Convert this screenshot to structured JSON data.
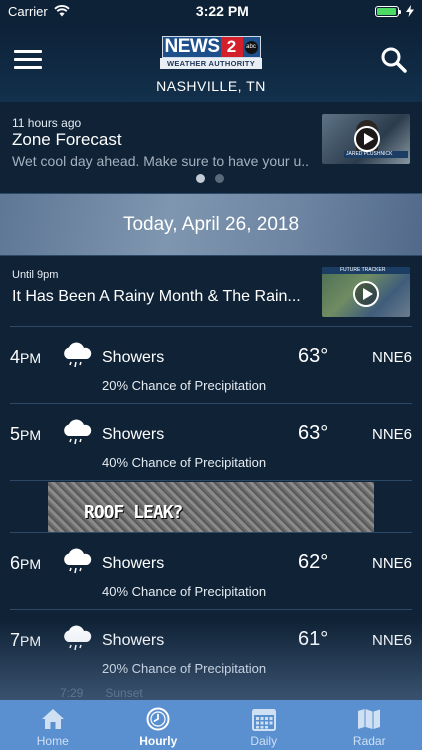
{
  "status_bar": {
    "carrier": "Carrier",
    "time": "3:22 PM",
    "battery_level": 0.95
  },
  "header": {
    "logo_text": "NEWS",
    "logo_number": "2",
    "logo_abc": "abc",
    "logo_subtitle": "WEATHER AUTHORITY",
    "location": "NASHVILLE, TN"
  },
  "forecast_card": {
    "time_ago": "11 hours ago",
    "title": "Zone Forecast",
    "description": "Wet cool day ahead. Make sure to have your u...",
    "thumbnail_caption": "JARED PLUSHNICK",
    "dots_active_index": 0
  },
  "date_banner": {
    "text": "Today, April 26, 2018"
  },
  "story": {
    "until": "Until 9pm",
    "title": "It Has Been A Rainy Month & The Rain...",
    "thumbnail_caption": "FUTURE TRACKER"
  },
  "hourly": [
    {
      "hour": "4",
      "ampm": "PM",
      "condition": "Showers",
      "temp": "63°",
      "wind": "NNE6",
      "precip": "20% Chance of Precipitation"
    },
    {
      "hour": "5",
      "ampm": "PM",
      "condition": "Showers",
      "temp": "63°",
      "wind": "NNE6",
      "precip": "40% Chance of Precipitation"
    },
    {
      "hour": "6",
      "ampm": "PM",
      "condition": "Showers",
      "temp": "62°",
      "wind": "NNE6",
      "precip": "40% Chance of Precipitation"
    },
    {
      "hour": "7",
      "ampm": "PM",
      "condition": "Showers",
      "temp": "61°",
      "wind": "NNE6",
      "precip": "20% Chance of Precipitation"
    }
  ],
  "ad": {
    "text": "ROOF LEAK?"
  },
  "sunset_row": {
    "time": "7:29",
    "label": "Sunset"
  },
  "tabs": [
    {
      "label": "Home",
      "icon": "home-icon"
    },
    {
      "label": "Hourly",
      "icon": "clock-icon"
    },
    {
      "label": "Daily",
      "icon": "calendar-icon"
    },
    {
      "label": "Radar",
      "icon": "map-icon"
    }
  ],
  "active_tab": "Hourly",
  "colors": {
    "background": "#0f2236",
    "tab_bar": "#5a8fd0",
    "logo_red": "#d4202a",
    "logo_blue": "#1d4f8a",
    "battery": "#4cd964"
  }
}
